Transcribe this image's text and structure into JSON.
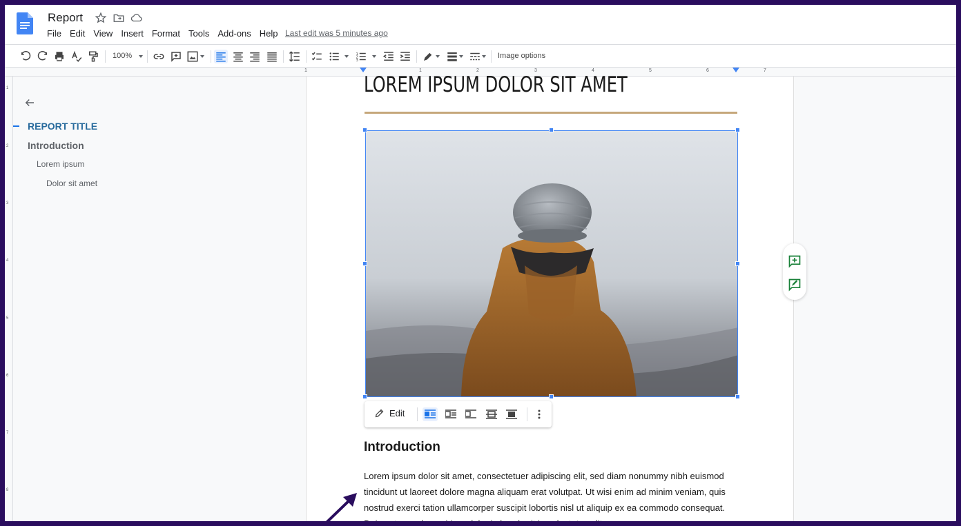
{
  "header": {
    "doc_title": "Report",
    "menu": [
      "File",
      "Edit",
      "View",
      "Insert",
      "Format",
      "Tools",
      "Add-ons",
      "Help"
    ],
    "last_edit": "Last edit was 5 minutes ago",
    "icons": [
      "docs-logo-icon",
      "star-icon",
      "move-folder-icon",
      "cloud-status-icon"
    ]
  },
  "toolbar": {
    "zoom": "100%",
    "image_options": "Image options",
    "icons": [
      "undo-icon",
      "redo-icon",
      "print-icon",
      "spellcheck-icon",
      "paint-format-icon",
      "link-icon",
      "comment-icon",
      "image-icon",
      "align-left-icon",
      "align-center-icon",
      "align-right-icon",
      "justify-icon",
      "line-spacing-icon",
      "checklist-icon",
      "bulleted-list-icon",
      "numbered-list-icon",
      "decrease-indent-icon",
      "increase-indent-icon",
      "border-color-icon",
      "border-weight-icon",
      "border-dash-icon"
    ]
  },
  "ruler": {
    "numbers": [
      "1",
      "1",
      "2",
      "3",
      "4",
      "5",
      "6",
      "7"
    ]
  },
  "vertical_ruler": {
    "numbers": [
      "1",
      "2",
      "3",
      "4",
      "5",
      "6",
      "7",
      "8"
    ]
  },
  "outline": {
    "items": [
      "REPORT TITLE",
      "Introduction",
      "Lorem ipsum",
      "Dolor sit amet"
    ]
  },
  "document": {
    "title": "LOREM IPSUM DOLOR SIT AMET",
    "heading": "Introduction",
    "body": "Lorem ipsum dolor sit amet, consectetuer adipiscing elit, sed diam nonummy nibh euismod tincidunt ut laoreet dolore magna aliquam erat volutpat. Ut wisi enim ad minim veniam, quis nostrud exerci tation ullamcorper suscipit lobortis nisl ut aliquip ex ea commodo consequat. Duis autem vel eum iriure dolor in hendrerit in vulputate velit esse"
  },
  "image_toolbar": {
    "edit_label": "Edit"
  },
  "colors": {
    "accent": "#1a73e8",
    "title_rule": "#c5a77a",
    "frame": "#2a0d5e",
    "selection": "#4285f4"
  }
}
